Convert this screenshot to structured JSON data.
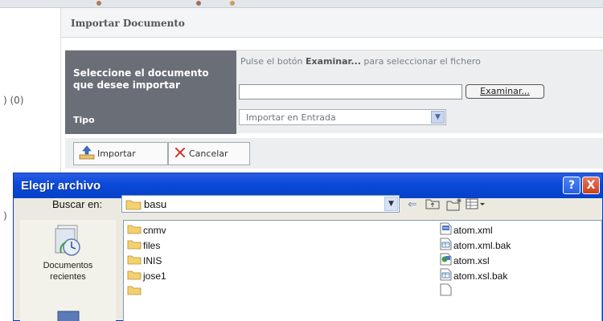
{
  "page": {
    "left_count": ") (0)",
    "left_paren": ")",
    "title": "Importar Documento",
    "select_label": "Seleccione el documento que desee importar",
    "hint_prefix": "Pulse el botón ",
    "hint_bold": "Examinar...",
    "hint_suffix": " para seleccionar el fichero",
    "file_input_value": "",
    "browse_label": "Examinar...",
    "type_label": "Tipo",
    "type_value": "Importar en Entrada",
    "import_button": "Importar",
    "cancel_button": "Cancelar"
  },
  "dialog": {
    "title": "Elegir archivo",
    "help_label": "?",
    "close_label": "X",
    "look_in_label": "Buscar en:",
    "look_in_value": "basu",
    "places": [
      {
        "label_line1": "Documentos",
        "label_line2": "recientes"
      }
    ],
    "folders": [
      "cnmv",
      "files",
      "INIS",
      "jose1"
    ],
    "files": [
      "atom.xml",
      "atom.xml.bak",
      "atom.xsl",
      "atom.xsl.bak"
    ]
  },
  "colors": {
    "titlebar": "#0a49d8",
    "form_label_bg": "#6a6e77",
    "dialog_bg": "#eceae0",
    "close_button": "#c8411e"
  },
  "icons": {
    "import": "upload-tray-icon",
    "cancel": "red-x-icon",
    "folder": "folder-icon",
    "xml": "xml-file-icon",
    "xsl": "xsl-file-icon",
    "bak": "bak-file-icon",
    "recent": "recent-documents-icon"
  }
}
